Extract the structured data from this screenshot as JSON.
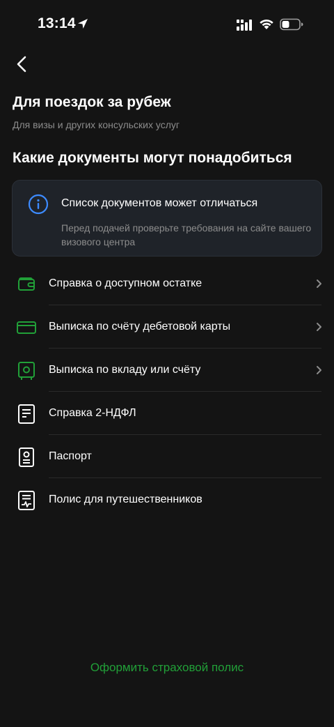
{
  "status_bar": {
    "time": "13:14"
  },
  "header": {
    "title": "Для поездок за рубеж",
    "subtitle": "Для визы и других консульских услуг"
  },
  "section": {
    "title": "Какие документы могут понадобиться"
  },
  "info_card": {
    "icon": "info-icon",
    "title": "Список документов может отличаться",
    "text": "Перед подачей проверьте требования на сайте вашего визового центра"
  },
  "documents": [
    {
      "label": "Справка о доступном остатке",
      "icon": "wallet-icon",
      "has_chevron": true
    },
    {
      "label": "Выписка по счёту дебетовой карты",
      "icon": "card-icon",
      "has_chevron": true
    },
    {
      "label": "Выписка по вкладу или счёту",
      "icon": "safe-icon",
      "has_chevron": true
    },
    {
      "label": "Справка 2-НДФЛ",
      "icon": "document-icon",
      "has_chevron": false
    },
    {
      "label": "Паспорт",
      "icon": "passport-icon",
      "has_chevron": false
    },
    {
      "label": "Полис для путешественников",
      "icon": "policy-icon",
      "has_chevron": false
    }
  ],
  "cta": {
    "label": "Оформить страховой полис"
  },
  "colors": {
    "background": "#141414",
    "accent_green": "#21a038",
    "info_blue": "#3d8bff",
    "card_bg": "#1f2329",
    "secondary_text": "#8c8c8c"
  }
}
